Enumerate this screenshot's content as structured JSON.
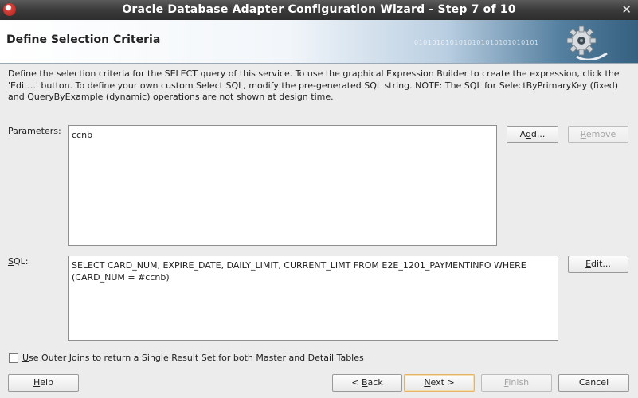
{
  "window": {
    "title": "Oracle Database Adapter Configuration Wizard - Step 7 of 10",
    "close_glyph": "✕"
  },
  "header": {
    "title": "Define Selection Criteria",
    "binary_text": "0101010101010101010101010101"
  },
  "description": "Define the selection criteria for the SELECT query of this service.  To use the graphical Expression Builder to create the expression, click the 'Edit...' button.  To define your own custom Select SQL, modify the pre-generated SQL string.  NOTE: The SQL for SelectByPrimaryKey (fixed) and QueryByExample (dynamic) operations are not shown at design time.",
  "parameters": {
    "label_mn": "P",
    "label_rest": "arameters:",
    "values": "ccnb"
  },
  "sql": {
    "label_mn": "S",
    "label_rest": "QL:",
    "text": "SELECT CARD_NUM, EXPIRE_DATE, DAILY_LIMIT, CURRENT_LIMT FROM E2E_1201_PAYMENTINFO WHERE\n(CARD_NUM = #ccnb)"
  },
  "buttons": {
    "add_a": "A",
    "add_mn": "d",
    "add_rest": "d...",
    "remove_mn": "R",
    "remove_rest": "emove",
    "edit_mn": "E",
    "edit_rest": "dit...",
    "help_mn": "H",
    "help_rest": "elp",
    "back_a": "< ",
    "back_mn": "B",
    "back_rest": "ack",
    "next_mn": "N",
    "next_rest": "ext >",
    "finish_mn": "F",
    "finish_rest": "inish",
    "cancel": "Cancel"
  },
  "outer_joins": {
    "label_mn": "U",
    "label_rest": "se Outer Joins to return a Single Result Set for both Master and Detail Tables",
    "checked": false
  },
  "icons": [
    "app-icon",
    "close-icon",
    "gear-icon"
  ],
  "colors": {
    "titlebar": "#3b3b3b",
    "header_accent": "#36607f",
    "default_button_border": "#e3b36a"
  }
}
